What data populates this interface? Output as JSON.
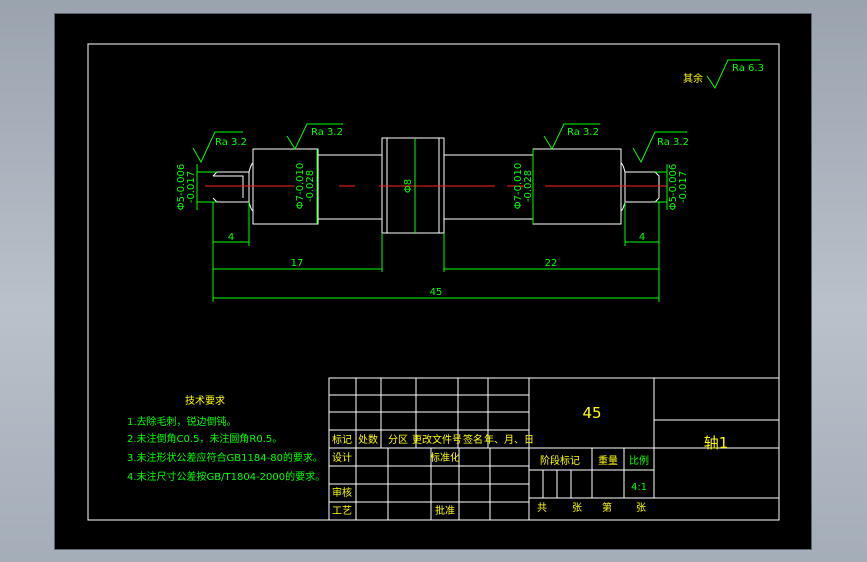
{
  "roughness": {
    "general": {
      "prefix": "其余",
      "label": "Ra 6.3"
    },
    "left_end": "Ra 3.2",
    "left_journal": "Ra 3.2",
    "right_journal": "Ra 3.2",
    "right_end": "Ra 3.2"
  },
  "diameters": {
    "left_end": "Φ5-0.006\n-0.017",
    "left_journal": "Φ7-0.010\n-0.028",
    "collar": "Φ8",
    "right_journal": "Φ7-0.010\n-0.028",
    "right_end": "Φ5-0.006\n-0.017"
  },
  "dimensions": {
    "left_end_length": "4",
    "right_end_length": "4",
    "left_section": "17",
    "right_section": "22",
    "overall": "45"
  },
  "tech_requirements": {
    "title": "技术要求",
    "items": [
      "1.去除毛刺，锐边倒钝。",
      "2.未注倒角C0.5，未注圆角R0.5。",
      "3.未注形状公差应符合GB1184-80的要求。",
      "4.未注尺寸公差按GB/T1804-2000的要求。"
    ]
  },
  "title_block": {
    "material": "45",
    "part_name": "轴1",
    "scale_value": "4:1",
    "rev_headers": [
      "标记",
      "处数",
      "分区",
      "更改文件号",
      "签名",
      "年、月、日"
    ],
    "design": "设计",
    "standardize": "标准化",
    "review": "审核",
    "process": "工艺",
    "approve": "批准",
    "stage_mark": "阶段标记",
    "weight": "重量",
    "scale": "比例",
    "total": "共",
    "sheets": "张",
    "page_no": "第",
    "sheet_unit": "张"
  }
}
